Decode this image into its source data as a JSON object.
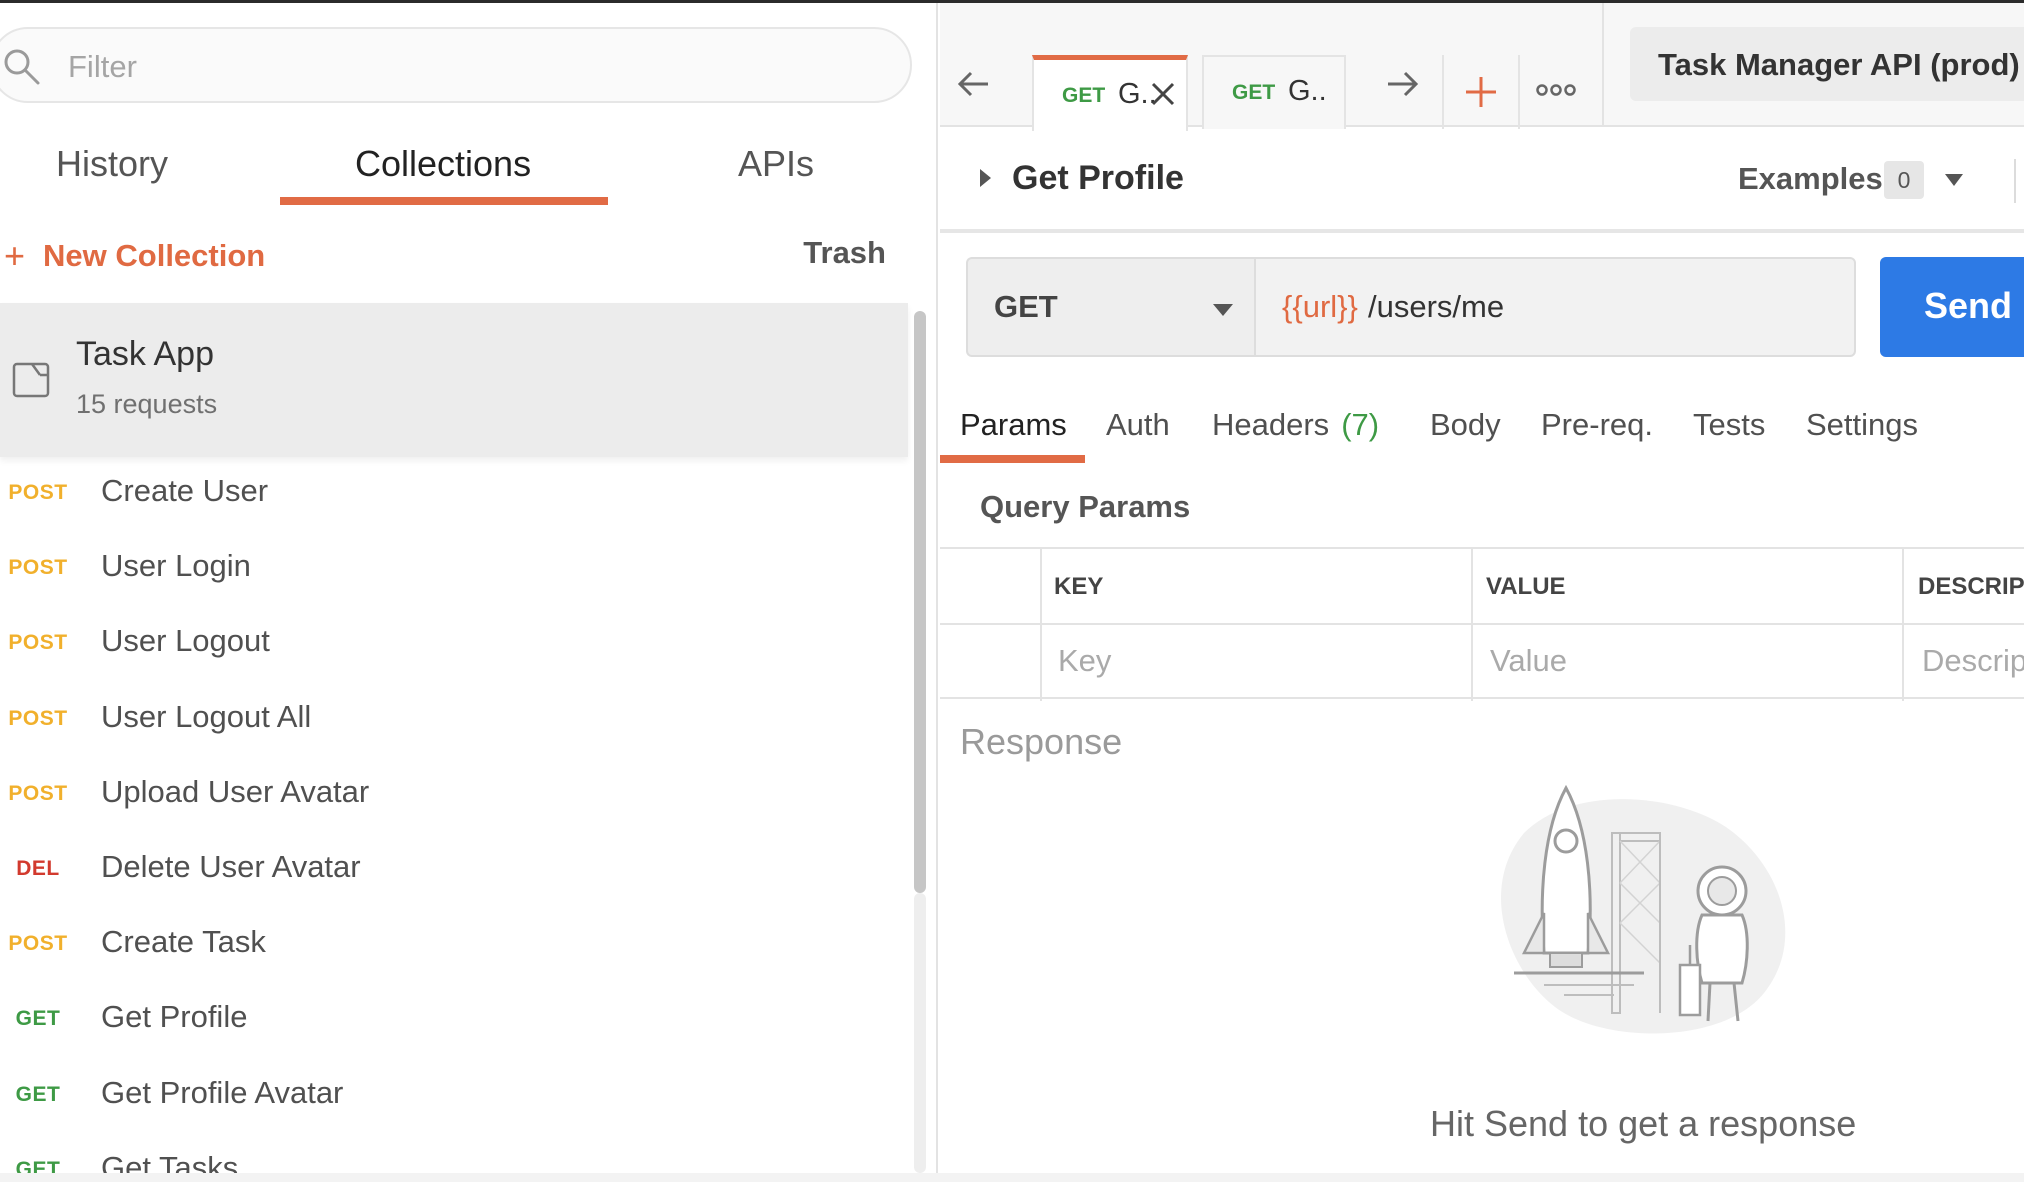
{
  "sidebar": {
    "filter_placeholder": "Filter",
    "tabs": [
      {
        "label": "History"
      },
      {
        "label": "Collections"
      },
      {
        "label": "APIs"
      }
    ],
    "active_tab": "Collections",
    "new_collection_label": "New Collection",
    "trash_label": "Trash",
    "collection": {
      "name": "Task App",
      "count": "15 requests"
    },
    "requests": [
      {
        "method": "POST",
        "name": "Create User"
      },
      {
        "method": "POST",
        "name": "User Login"
      },
      {
        "method": "POST",
        "name": "User Logout"
      },
      {
        "method": "POST",
        "name": "User Logout All"
      },
      {
        "method": "POST",
        "name": "Upload User Avatar"
      },
      {
        "method": "DEL",
        "name": "Delete User Avatar"
      },
      {
        "method": "POST",
        "name": "Create Task"
      },
      {
        "method": "GET",
        "name": "Get Profile"
      },
      {
        "method": "GET",
        "name": "Get Profile Avatar"
      },
      {
        "method": "GET",
        "name": "Get Tasks"
      }
    ]
  },
  "tabbar": {
    "tabs": [
      {
        "method": "GET",
        "name": "G.."
      },
      {
        "method": "GET",
        "name": "G.."
      }
    ],
    "environment": "Task Manager API (prod)"
  },
  "request": {
    "title": "Get Profile",
    "examples_label": "Examples",
    "examples_count": "0",
    "method": "GET",
    "url_variable": "{{url}}",
    "url_path": "/users/me",
    "send_label": "Send",
    "subtabs": [
      {
        "label": "Params"
      },
      {
        "label": "Auth"
      },
      {
        "label": "Headers",
        "count": "(7)"
      },
      {
        "label": "Body"
      },
      {
        "label": "Pre-req."
      },
      {
        "label": "Tests"
      },
      {
        "label": "Settings"
      }
    ],
    "query_params_label": "Query Params",
    "table": {
      "headers": [
        "KEY",
        "VALUE",
        "DESCRIPT"
      ],
      "placeholders": [
        "Key",
        "Value",
        "Descrip"
      ]
    }
  },
  "response": {
    "label": "Response",
    "empty_message": "Hit Send to get a response"
  },
  "colors": {
    "accent": "#e16b45",
    "send": "#2d7ae5",
    "post": "#f1b02c",
    "get": "#3e9a45",
    "del": "#d23a2e"
  }
}
